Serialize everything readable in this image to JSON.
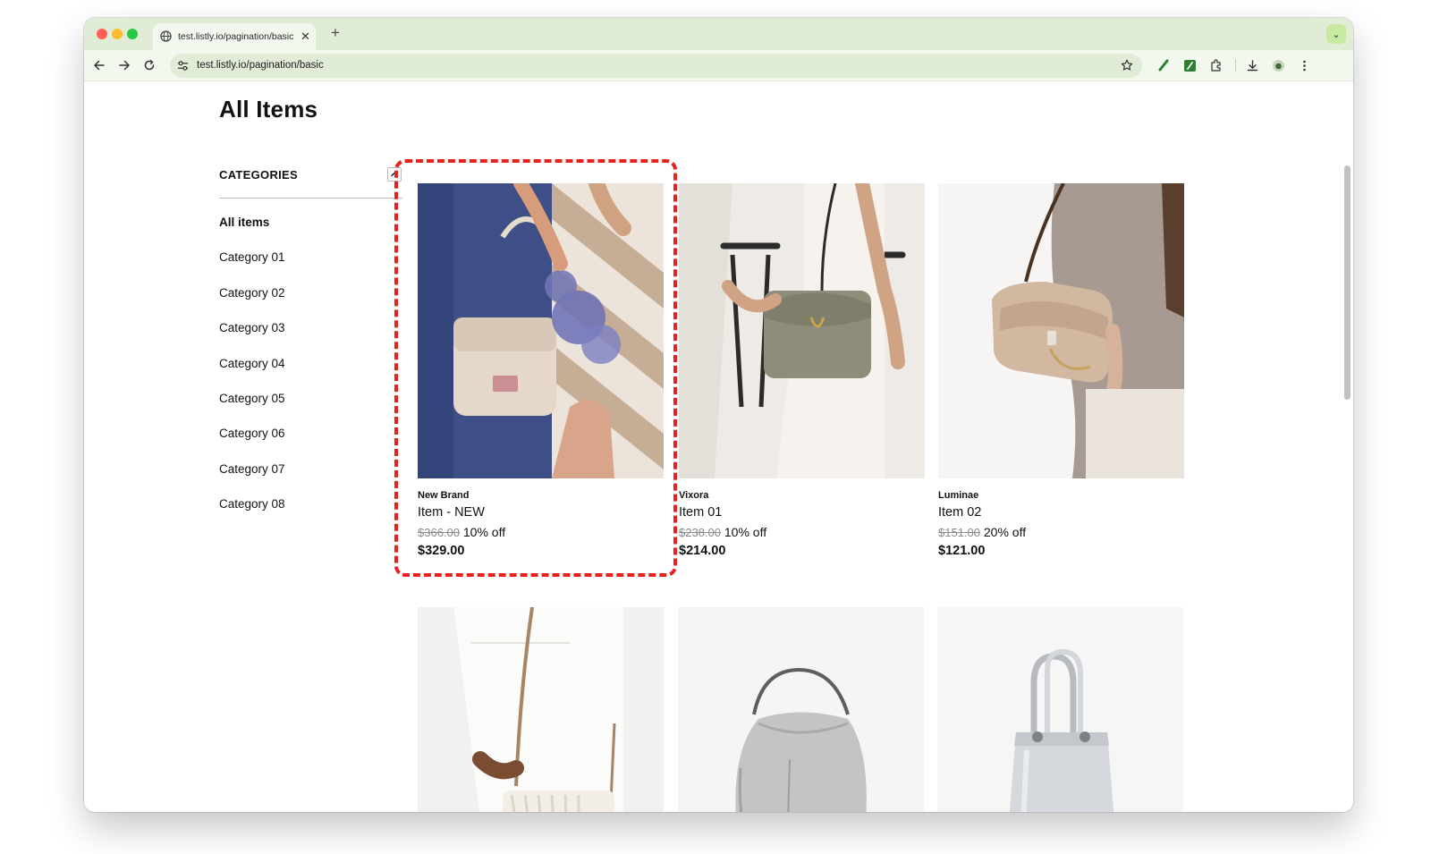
{
  "browser": {
    "tab_title": "test.listly.io/pagination/basic",
    "tab_close": "✕",
    "new_tab": "+",
    "tab_search": "⌄",
    "address": "test.listly.io/pagination/basic"
  },
  "page": {
    "title": "All Items",
    "categories_heading": "CATEGORIES",
    "categories": [
      {
        "label": "All items",
        "active": true
      },
      {
        "label": "Category 01"
      },
      {
        "label": "Category 02"
      },
      {
        "label": "Category 03"
      },
      {
        "label": "Category 04"
      },
      {
        "label": "Category 05"
      },
      {
        "label": "Category 06"
      },
      {
        "label": "Category 07"
      },
      {
        "label": "Category 08"
      }
    ],
    "products": [
      {
        "brand": "New Brand",
        "name": "Item - NEW",
        "original_price": "$366.00",
        "discount": "10% off",
        "price": "$329.00"
      },
      {
        "brand": "Vixora",
        "name": "Item 01",
        "original_price": "$238.00",
        "discount": "10% off",
        "price": "$214.00"
      },
      {
        "brand": "Luminae",
        "name": "Item 02",
        "original_price": "$151.00",
        "discount": "20% off",
        "price": "$121.00"
      }
    ]
  },
  "colors": {
    "highlight": "#e8211f",
    "tabstrip": "#e0ecd6",
    "toolbar": "#f3f8ee"
  }
}
